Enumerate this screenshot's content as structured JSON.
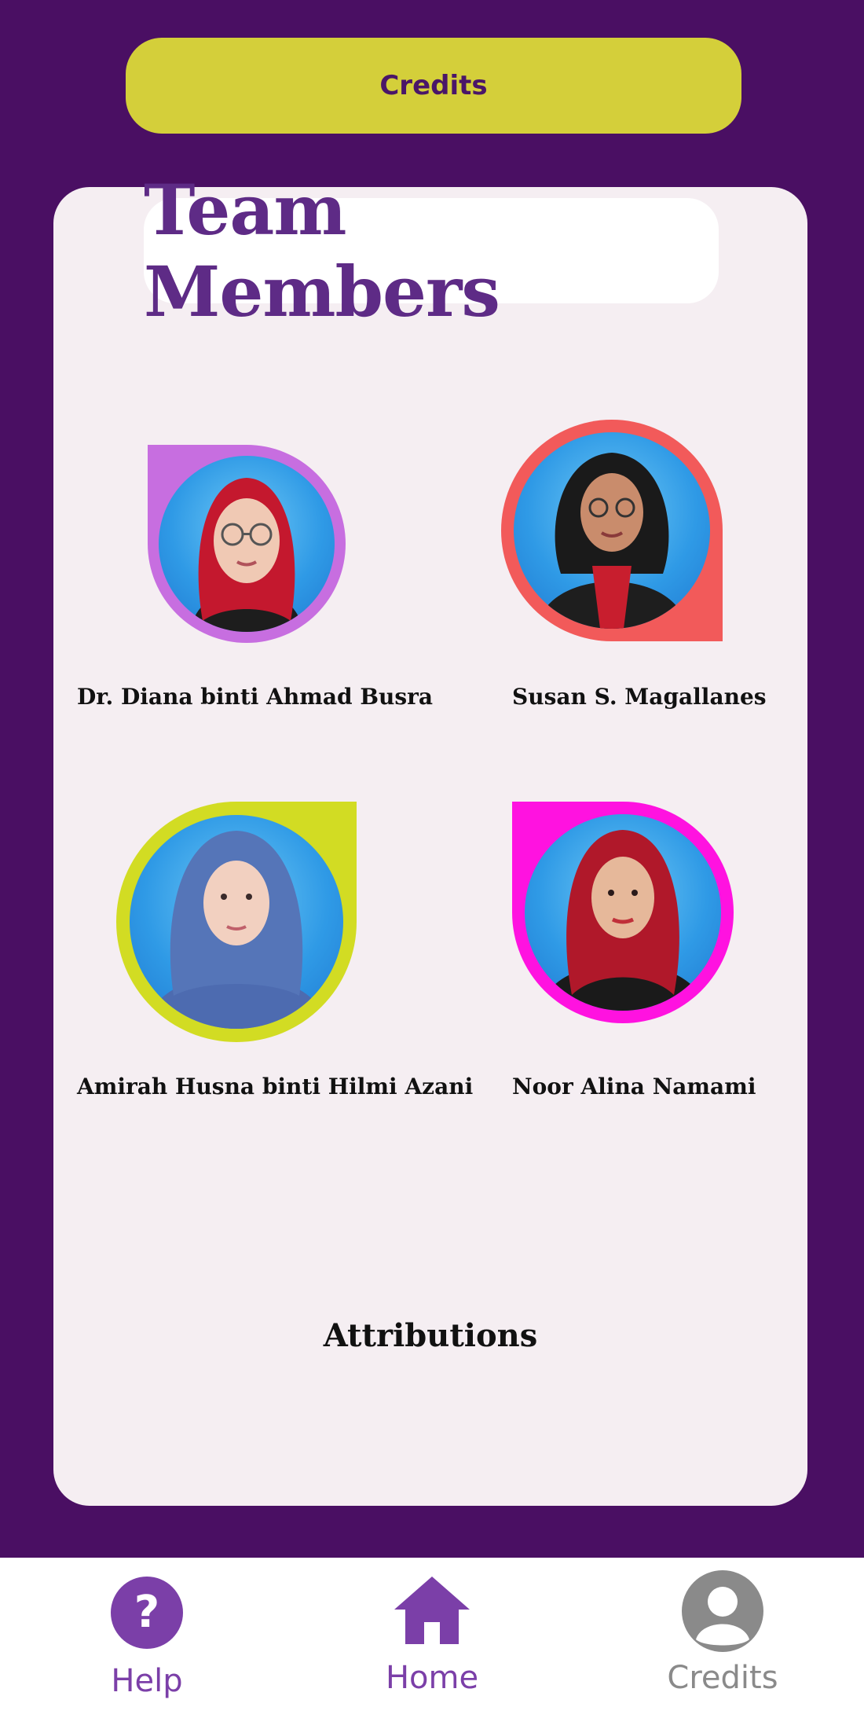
{
  "header": {
    "title": "Credits"
  },
  "card": {
    "title": "Team Members",
    "members": [
      {
        "name": "Dr. Diana binti Ahmad Busra",
        "frame_color": "#c76ee0",
        "hijab_color": "#c4182e",
        "clothing_color": "#1d1d1d"
      },
      {
        "name": "Susan S. Magallanes",
        "frame_color": "#f25a5a",
        "hijab_color": "#1a1a1a",
        "clothing_color": "#1e1e1e"
      },
      {
        "name": "Amirah Husna binti Hilmi Azani",
        "frame_color": "#d2dc23",
        "hijab_color": "#4d6bb0",
        "clothing_color": "#4d6bb0"
      },
      {
        "name": "Noor Alina Namami",
        "frame_color": "#ff12e0",
        "hijab_color": "#b0182a",
        "clothing_color": "#1a1a1a"
      }
    ],
    "attributions_label": "Attributions"
  },
  "nav": {
    "items": [
      {
        "label": "Help",
        "icon": "help-circle-icon",
        "color": "#7b3fa8"
      },
      {
        "label": "Home",
        "icon": "home-icon",
        "color": "#7b3fa8"
      },
      {
        "label": "Credits",
        "icon": "user-circle-icon",
        "color": "#8a8a8a"
      }
    ]
  },
  "colors": {
    "background": "#4a0f63",
    "accent_yellow": "#d4cf3a",
    "title_purple": "#5e2b86",
    "card": "#f5eef2"
  }
}
